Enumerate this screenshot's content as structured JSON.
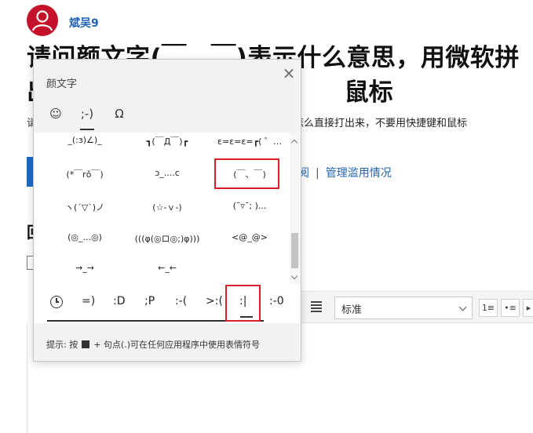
{
  "post": {
    "username": "斌吴9",
    "title_line1": "请问颜文字(￣、￣)表示什么意思，用微软拼",
    "title_line2_left": "出",
    "title_line2_right": "鼠标",
    "desc_left": "请",
    "desc_right": "怎么直接打出来，不要用快捷键和鼠标",
    "links": [
      "阅",
      "管理滥用情况"
    ],
    "section_heading": "回"
  },
  "editor": {
    "style_value": "标准"
  },
  "emoji_panel": {
    "title": "颜文字",
    "close_label": "×",
    "tabs": [
      {
        "label": "☺",
        "active": false
      },
      {
        "label": ";-)",
        "active": true
      },
      {
        "label": "Ω",
        "active": false
      }
    ],
    "kaomoji_rows": [
      [
        "_(:з)∠)_",
        "┓(￣Д￣)┏",
        "ε=ε=ε=┏( ゜…"
      ],
      [
        "(*￣rǒ￣)",
        "ↄ_....c",
        "(￣、￣)"
      ],
      [
        "ヽ(´▽`)ノ",
        "(☆-ｖ-)",
        "(¯▿¯;  )..."
      ],
      [
        "(◎_...◎)",
        "(((φ(◎ロ◎;)φ)))",
        "<@_@>"
      ],
      [
        "→_→",
        "←_←",
        ""
      ]
    ],
    "recent": [
      ":-)",
      "=)",
      ":D",
      ";P",
      ":-(",
      ">:(",
      ":|",
      ":-0"
    ],
    "hint": "提示: 按   + 句点(.)可在任何应用程序中使用表情符号",
    "hint_prefix": "提示: 按",
    "hint_suffix": "+ 句点(.)可在任何应用程序中使用表情符号"
  },
  "colors": {
    "highlight": "#d8202a",
    "link": "#1f63b3",
    "avatar": "#c4122a"
  }
}
